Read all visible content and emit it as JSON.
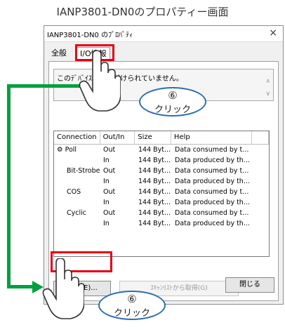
{
  "caption": "IANP3801-DN0のプロパティー画面",
  "dialog": {
    "title": "IANP3801-DN0 のﾌﾟﾛﾊﾟﾃｨ",
    "close_glyph": "×",
    "tabs": [
      {
        "label": "全般"
      },
      {
        "label": "I/O情報"
      }
    ],
    "description": "このﾃﾞﾊﾞｲｽの     ﾞ、     付けられていません。",
    "table": {
      "columns": [
        "Connection",
        "Out/In",
        "Size",
        "Help"
      ],
      "rows": [
        {
          "connection": "Poll",
          "outin": "Out",
          "size": "144 Byt...",
          "help": "Data consumed by t..."
        },
        {
          "connection": "",
          "outin": "In",
          "size": "144 Byt...",
          "help": "Data produced by th..."
        },
        {
          "connection": "Bit-Strobe",
          "outin": "Out",
          "size": "144 Byt...",
          "help": "Data consumed by t..."
        },
        {
          "connection": "",
          "outin": "In",
          "size": "144 Byt...",
          "help": "Data produced by th..."
        },
        {
          "connection": "COS",
          "outin": "Out",
          "size": "144 Byt...",
          "help": "Data consumed by t..."
        },
        {
          "connection": "",
          "outin": "In",
          "size": "144 Byt...",
          "help": "Data produced by th..."
        },
        {
          "connection": "Cyclic",
          "outin": "Out",
          "size": "144 Byt...",
          "help": "Data consumed by t..."
        },
        {
          "connection": "",
          "outin": "In",
          "size": "144 Byt...",
          "help": "Data produced by th..."
        }
      ]
    },
    "edit_button": "編集(E)...",
    "scan_button": "ｽｷｬﾝﾘｽﾄから取得(G)",
    "close_button": "閉じる"
  },
  "callouts": [
    {
      "number": "⑥",
      "label": "クリック"
    },
    {
      "number": "⑥",
      "label": "クリック"
    }
  ],
  "colors": {
    "highlight": "#e60012",
    "arrow": "#00a03e",
    "bubble_border": "#2a6fb0"
  }
}
